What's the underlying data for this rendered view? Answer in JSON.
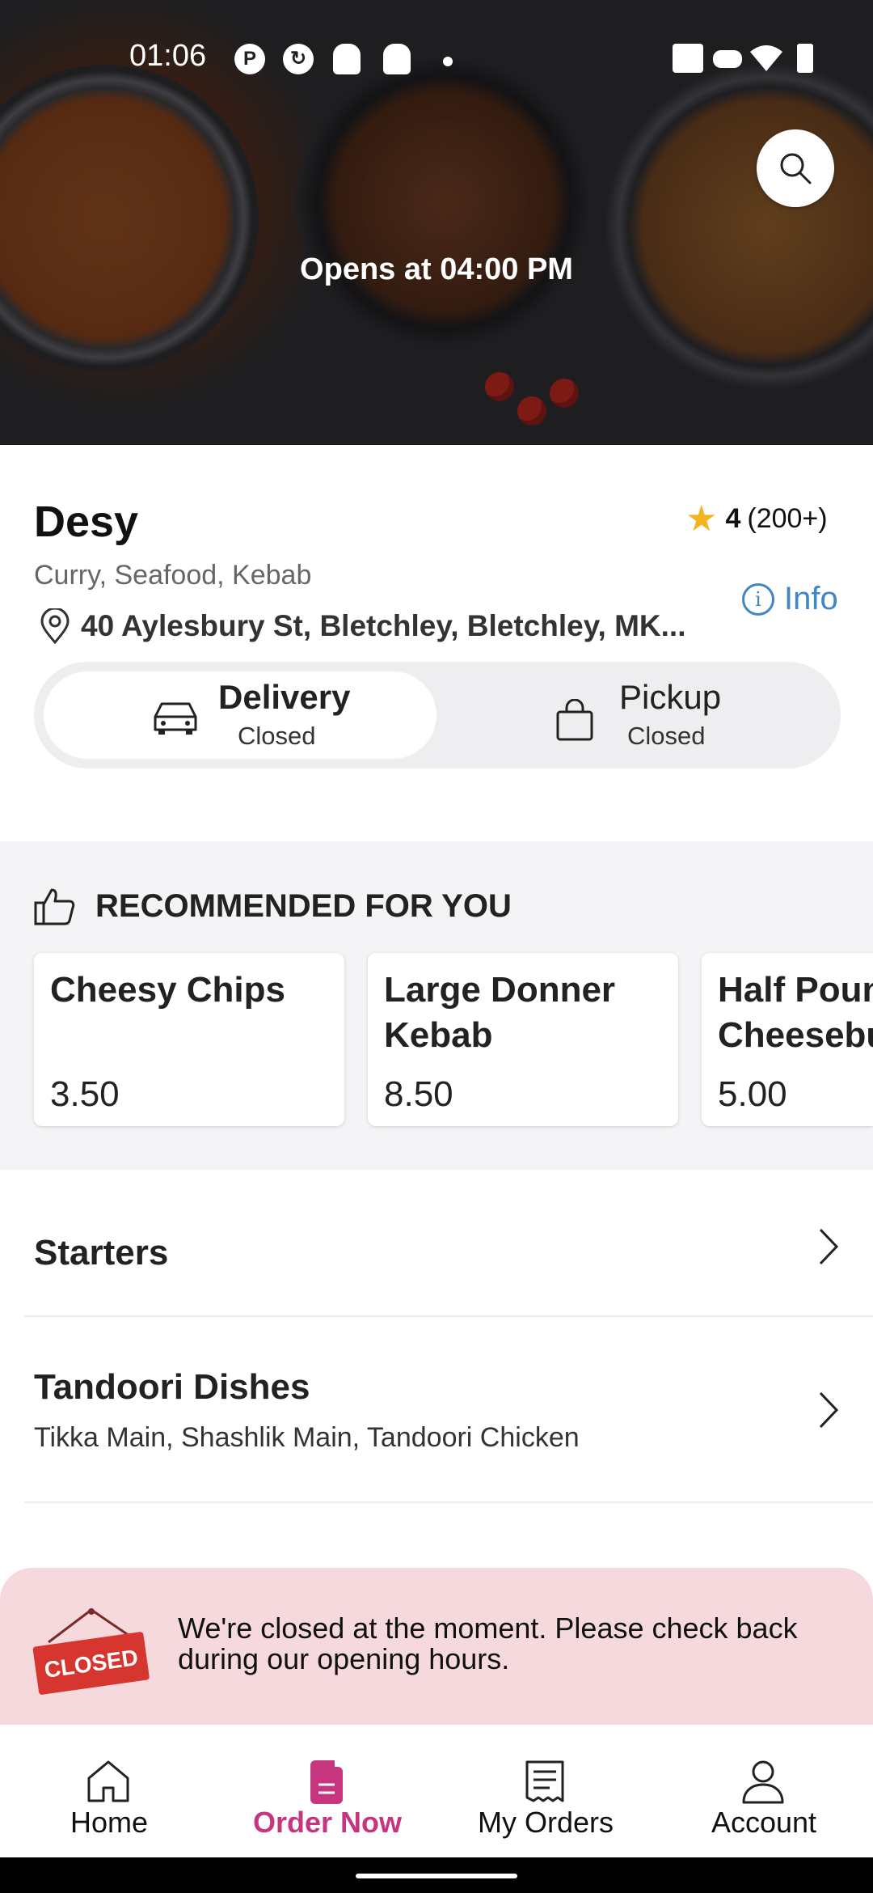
{
  "status_bar": {
    "time": "01:06"
  },
  "hero": {
    "opens_text": "Opens at 04:00 PM"
  },
  "restaurant": {
    "name": "Desy",
    "rating": "4",
    "rating_count": "(200+)",
    "cuisines": "Curry, Seafood, Kebab",
    "address": "40 Aylesbury St, Bletchley, Bletchley, MK...",
    "info_label": "Info"
  },
  "modes": {
    "delivery": {
      "label": "Delivery",
      "status": "Closed"
    },
    "pickup": {
      "label": "Pickup",
      "status": "Closed"
    }
  },
  "recommended": {
    "title": "RECOMMENDED FOR YOU",
    "items": [
      {
        "name": "Cheesy Chips",
        "price": "3.50"
      },
      {
        "name": "Large Donner\nKebab",
        "price": "8.50"
      },
      {
        "name": "Half Pound\nCheeseburger",
        "price": "5.00"
      }
    ]
  },
  "categories": [
    {
      "title": "Starters",
      "subtitle": ""
    },
    {
      "title": "Tandoori Dishes",
      "subtitle": "Tikka Main, Shashlik Main, Tandoori Chicken"
    }
  ],
  "closed_banner": {
    "sign_text": "CLOSED",
    "message": "We're closed at the moment. Please check back during our opening hours."
  },
  "bottom_nav": {
    "items": [
      {
        "label": "Home",
        "icon": "home-icon"
      },
      {
        "label": "Order Now",
        "icon": "order-icon"
      },
      {
        "label": "My Orders",
        "icon": "receipt-icon"
      },
      {
        "label": "Account",
        "icon": "person-icon"
      }
    ],
    "active_index": 1
  },
  "colors": {
    "accent": "#c8357f",
    "info_blue": "#3f86c4",
    "star": "#f4b321",
    "closed_bg": "#f5d9dd"
  }
}
